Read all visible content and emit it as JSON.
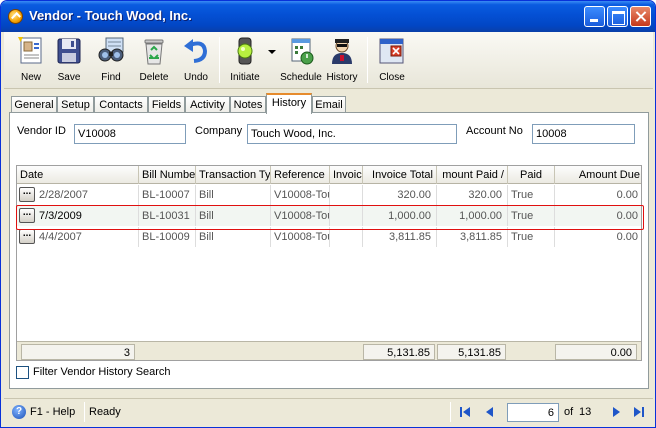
{
  "window": {
    "title": "Vendor - Touch Wood, Inc."
  },
  "toolbar": {
    "items": [
      {
        "label": "New",
        "icon": "new-icon"
      },
      {
        "label": "Save",
        "icon": "save-icon"
      },
      {
        "label": "Find",
        "icon": "find-icon"
      },
      {
        "label": "Delete",
        "icon": "delete-icon"
      },
      {
        "label": "Undo",
        "icon": "undo-icon"
      },
      {
        "label": "Initiate",
        "icon": "initiate-icon"
      },
      {
        "label": "Schedule",
        "icon": "schedule-icon"
      },
      {
        "label": "History",
        "icon": "history-icon"
      },
      {
        "label": "Close",
        "icon": "close-icon"
      }
    ]
  },
  "tabs": [
    "General",
    "Setup",
    "Contacts",
    "Fields",
    "Activity",
    "Notes",
    "History",
    "Email"
  ],
  "active_tab": "History",
  "form": {
    "vendor_id_label": "Vendor ID",
    "vendor_id_value": "V10008",
    "company_label": "Company",
    "company_value": "Touch Wood, Inc.",
    "account_no_label": "Account No",
    "account_no_value": "10008"
  },
  "grid": {
    "columns": [
      "Date",
      "Bill Number",
      "Transaction Ty",
      "Reference",
      "Invoic",
      "Invoice Total",
      "mount Paid /",
      "Paid",
      "Amount Due"
    ],
    "rows": [
      {
        "date": "2/28/2007",
        "bill_number": "BL-10007",
        "transaction_type": "Bill",
        "reference": "V10008-Tou",
        "invoice": "",
        "invoice_total": "320.00",
        "amount_paid": "320.00",
        "paid": "True",
        "amount_due": "0.00"
      },
      {
        "date": "7/3/2009",
        "bill_number": "BL-10031",
        "transaction_type": "Bill",
        "reference": "V10008-Tou",
        "invoice": "",
        "invoice_total": "1,000.00",
        "amount_paid": "1,000.00",
        "paid": "True",
        "amount_due": "0.00"
      },
      {
        "date": "4/4/2007",
        "bill_number": "BL-10009",
        "transaction_type": "Bill",
        "reference": "V10008-Tou",
        "invoice": "",
        "invoice_total": "3,811.85",
        "amount_paid": "3,811.85",
        "paid": "True",
        "amount_due": "0.00"
      }
    ],
    "footer": {
      "count": "3",
      "invoice_total": "5,131.85",
      "amount_paid": "5,131.85",
      "amount_due": "0.00"
    }
  },
  "filter": {
    "label": "Filter Vendor History Search",
    "checked": false
  },
  "status": {
    "help": "F1 - Help",
    "state": "Ready",
    "page_current": "6",
    "page_of": "of",
    "page_total": "13"
  },
  "colors": {
    "title_bar": "#0450d4",
    "active_tab_accent": "#e68b2c",
    "highlight": "#e01010",
    "accent": "#1a4fb5"
  }
}
